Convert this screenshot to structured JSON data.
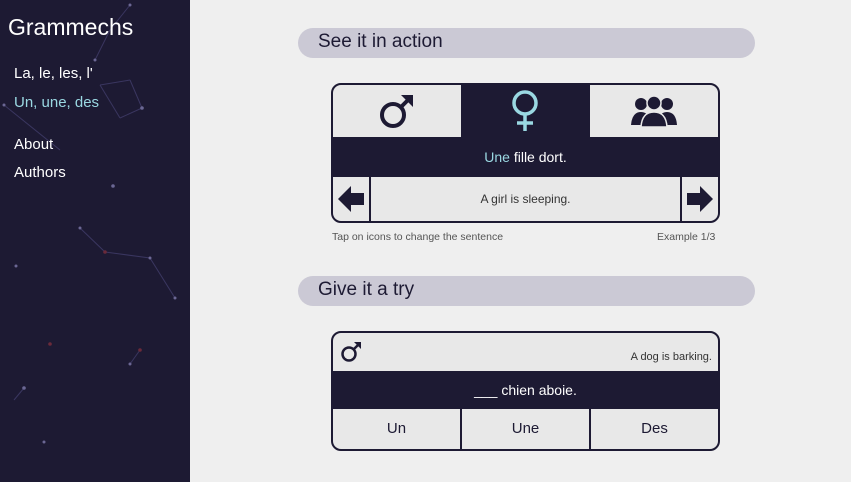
{
  "app": {
    "title": "Grammechs"
  },
  "sidebar": {
    "items": [
      {
        "label": "La, le, les, l'",
        "active": false
      },
      {
        "label": "Un, une, des",
        "active": true
      },
      {
        "label": "About",
        "active": false
      },
      {
        "label": "Authors",
        "active": false
      }
    ]
  },
  "colors": {
    "sidebar_bg": "#1d1a33",
    "accent": "#9ad8e2",
    "section_bg": "#cbc9d5",
    "card_light": "#e8e8e8"
  },
  "action": {
    "heading": "See it in action",
    "tabs": [
      {
        "icon": "male-symbol-icon",
        "selected": false
      },
      {
        "icon": "female-symbol-icon",
        "selected": true
      },
      {
        "icon": "group-icon",
        "selected": false
      }
    ],
    "sentence_article": "Une",
    "sentence_rest": " fille dort.",
    "translation": "A girl is sleeping.",
    "prev_icon": "arrow-left-icon",
    "next_icon": "arrow-right-icon",
    "hint": "Tap on icons to change the sentence",
    "counter": "Example 1/3"
  },
  "try": {
    "heading": "Give it a try",
    "gender_icon": "male-symbol-icon",
    "english": "A dog is barking.",
    "sentence": "___ chien aboie.",
    "choices": [
      "Un",
      "Une",
      "Des"
    ]
  }
}
